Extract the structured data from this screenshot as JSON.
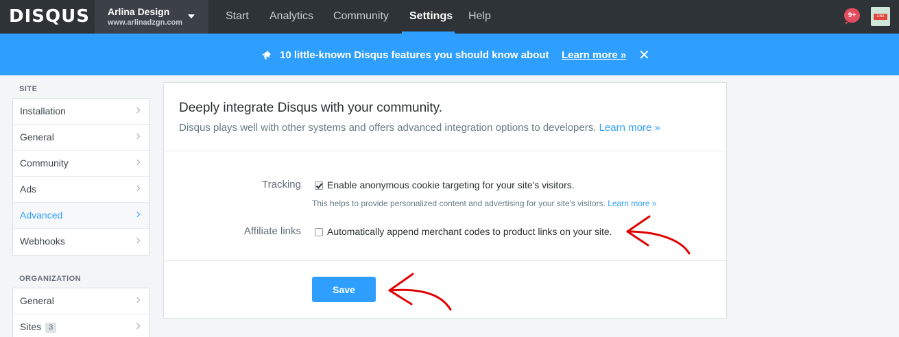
{
  "topnav": {
    "logo": "DISQUS",
    "site_name": "Arlina Design",
    "site_url": "www.arlinadzgn.com",
    "links": [
      "Start",
      "Analytics",
      "Community",
      "Settings",
      "Help"
    ],
    "active_link": "Settings",
    "notification_count": "9+",
    "avatar_label": "LINA"
  },
  "banner": {
    "text": "10 little-known Disqus features you should know about",
    "link": "Learn more »",
    "close": "✕"
  },
  "sidebar": {
    "site_heading": "SITE",
    "site_items": [
      {
        "label": "Installation"
      },
      {
        "label": "General"
      },
      {
        "label": "Community"
      },
      {
        "label": "Ads"
      },
      {
        "label": "Advanced",
        "active": true
      },
      {
        "label": "Webhooks"
      }
    ],
    "org_heading": "ORGANIZATION",
    "org_items": [
      {
        "label": "General"
      },
      {
        "label": "Sites",
        "badge": "3"
      }
    ]
  },
  "main": {
    "title": "Deeply integrate Disqus with your community.",
    "subtitle": "Disqus plays well with other systems and offers advanced integration options to developers.",
    "subtitle_link": "Learn more »",
    "tracking": {
      "label": "Tracking",
      "checkbox_label": "Enable anonymous cookie targeting for your site's visitors.",
      "checked": true,
      "help": "This helps to provide personalized content and advertising for your site's visitors.",
      "help_link": "Learn more »"
    },
    "affiliate": {
      "label": "Affiliate links",
      "checkbox_label": "Automatically append merchant codes to product links on your site.",
      "checked": false
    },
    "save_label": "Save"
  },
  "colors": {
    "nav_bg": "#2e3338",
    "accent": "#2e9fff",
    "annotation": "#e00000"
  }
}
